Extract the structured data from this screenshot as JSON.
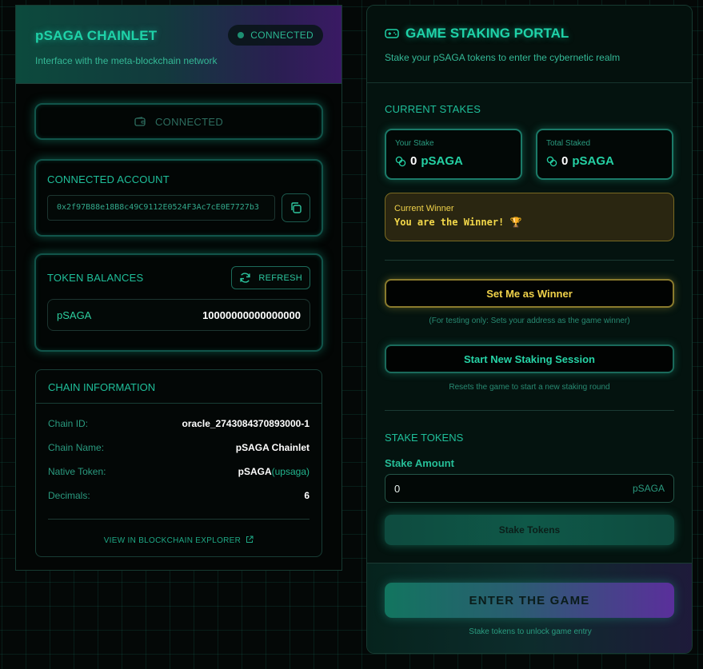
{
  "chainlet": {
    "title": "pSAGA CHAINLET",
    "subtitle": "Interface with the meta-blockchain network",
    "status": "CONNECTED",
    "connect_button": "CONNECTED",
    "account": {
      "label": "CONNECTED ACCOUNT",
      "address": "0x2f97B88e18B8c49C9112E0524F3Ac7cE0E7727b3"
    },
    "tokens": {
      "label": "TOKEN BALANCES",
      "refresh": "REFRESH",
      "items": [
        {
          "token": "pSAGA",
          "balance": "10000000000000000"
        }
      ]
    },
    "chain_info": {
      "label": "CHAIN INFORMATION",
      "chain_id_key": "Chain ID:",
      "chain_id": "oracle_2743084370893000-1",
      "chain_name_key": "Chain Name:",
      "chain_name": "pSAGA Chainlet",
      "native_token_key": "Native Token:",
      "native_token": "pSAGA",
      "native_denom": "(upsaga)",
      "decimals_key": "Decimals:",
      "decimals": "6",
      "explorer_link": "VIEW IN BLOCKCHAIN EXPLORER"
    }
  },
  "portal": {
    "title": "GAME STAKING PORTAL",
    "subtitle": "Stake your pSAGA tokens to enter the cybernetic realm",
    "current_stakes_label": "CURRENT STAKES",
    "your_stake": {
      "label": "Your Stake",
      "amount": "0",
      "token": "pSAGA"
    },
    "total_staked": {
      "label": "Total Staked",
      "amount": "0",
      "token": "pSAGA"
    },
    "winner": {
      "label": "Current Winner",
      "value": "You are the Winner! 🏆"
    },
    "set_winner_button": "Set Me as Winner",
    "set_winner_note": "(For testing only: Sets your address as the game winner)",
    "new_session_button": "Start New Staking Session",
    "new_session_note": "Resets the game to start a new staking round",
    "stake_tokens_label": "STAKE TOKENS",
    "amount_label": "Stake Amount",
    "amount_value": "0",
    "amount_unit": "pSAGA",
    "stake_button": "Stake Tokens",
    "enter_button": "ENTER THE GAME",
    "enter_note": "Stake tokens to unlock game entry"
  },
  "icons": {
    "wallet": "wallet-icon",
    "copy": "copy-icon",
    "refresh": "refresh-icon",
    "external": "external-link-icon",
    "gamepad": "gamepad-icon",
    "coins": "coins-icon"
  },
  "colors": {
    "accent": "#1fd2a8",
    "winner": "#f0d24a",
    "purple": "#5a2f9b"
  }
}
